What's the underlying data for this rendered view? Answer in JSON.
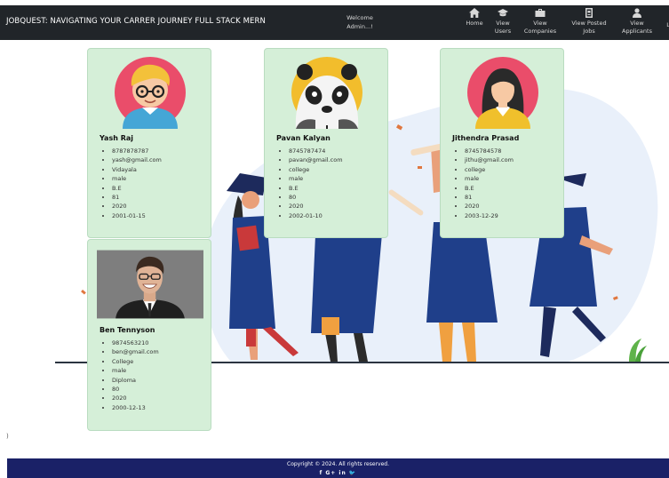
{
  "navbar": {
    "brand": "JOBQUEST: NAVIGATING YOUR CARRER JOURNEY FULL STACK MERN",
    "welcome_line1": "Welcome",
    "welcome_line2": "Admin...!",
    "items": [
      {
        "label": "Home",
        "icon": "home-icon"
      },
      {
        "label": "View Users",
        "icon": "graduation-cap-icon"
      },
      {
        "label": "View Companies",
        "icon": "briefcase-icon"
      },
      {
        "label": "View Posted Jobs",
        "icon": "id-card-icon"
      },
      {
        "label": "View Applicants",
        "icon": "user-icon"
      }
    ],
    "logout_label": "Lo"
  },
  "applicants": [
    {
      "name": "Yash Raj",
      "avatar": "boy-with-glasses-avatar",
      "details": [
        "8787878787",
        "yash@gmail.com",
        "Vidayala",
        "male",
        "B.E",
        "81",
        "2020",
        "2001-01-15"
      ]
    },
    {
      "name": "Pavan Kalyan",
      "avatar": "panda-avatar",
      "details": [
        "8745787474",
        "pavan@gmail.com",
        "college",
        "male",
        "B.E",
        "80",
        "2020",
        "2002-01-10"
      ]
    },
    {
      "name": "Jithendra Prasad",
      "avatar": "woman-avatar",
      "details": [
        "8745784578",
        "jithu@gmail.com",
        "college",
        "male",
        "B.E",
        "81",
        "2020",
        "2003-12-29"
      ]
    },
    {
      "name": "Ben Tennyson",
      "avatar": "smiling-man-photo",
      "details": [
        "9874563210",
        "ben@gmail.com",
        "College",
        "male",
        "Diploma",
        "80",
        "2020",
        "2000-12-13"
      ]
    }
  ],
  "stray_char": ")",
  "footer": {
    "copyright": "Copyright © 2024. All rights reserved.",
    "social": [
      "f",
      "G+",
      "in",
      "🐦"
    ]
  },
  "colors": {
    "navbar_bg": "#212529",
    "card_bg": "#d5efd8",
    "footer_bg": "#1a2167",
    "gown_blue": "#1f3f8a"
  }
}
